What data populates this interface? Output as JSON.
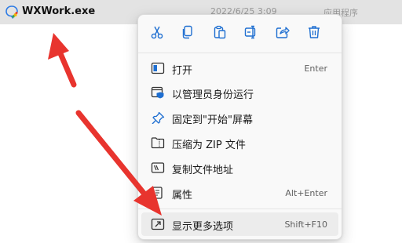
{
  "file": {
    "name": "WXWork.exe",
    "date": "2022/6/25 3:09",
    "type": "应用程序",
    "icon": "wxwork-app-icon"
  },
  "quick_actions": [
    {
      "icon": "cut-icon"
    },
    {
      "icon": "copy-icon"
    },
    {
      "icon": "paste-icon"
    },
    {
      "icon": "rename-icon"
    },
    {
      "icon": "share-icon"
    },
    {
      "icon": "delete-icon"
    }
  ],
  "menu": {
    "items": [
      {
        "label": "打开",
        "shortcut": "Enter",
        "icon": "open-window-icon"
      },
      {
        "label": "以管理员身份运行",
        "shortcut": "",
        "icon": "shield-run-icon"
      },
      {
        "label": "固定到\"开始\"屏幕",
        "shortcut": "",
        "icon": "pin-icon"
      },
      {
        "label": "压缩为 ZIP 文件",
        "shortcut": "",
        "icon": "zip-folder-icon"
      },
      {
        "label": "复制文件地址",
        "shortcut": "",
        "icon": "copy-path-icon"
      },
      {
        "label": "属性",
        "shortcut": "Alt+Enter",
        "icon": "properties-icon"
      },
      {
        "label": "显示更多选项",
        "shortcut": "Shift+F10",
        "icon": "more-options-icon"
      }
    ]
  },
  "colors": {
    "row_selected": "#e3e3e3",
    "menu_bg": "#f9f9f9",
    "menu_hover": "#ececec",
    "accent_blue": "#1f6fd1",
    "arrow_red": "#e8342e"
  }
}
